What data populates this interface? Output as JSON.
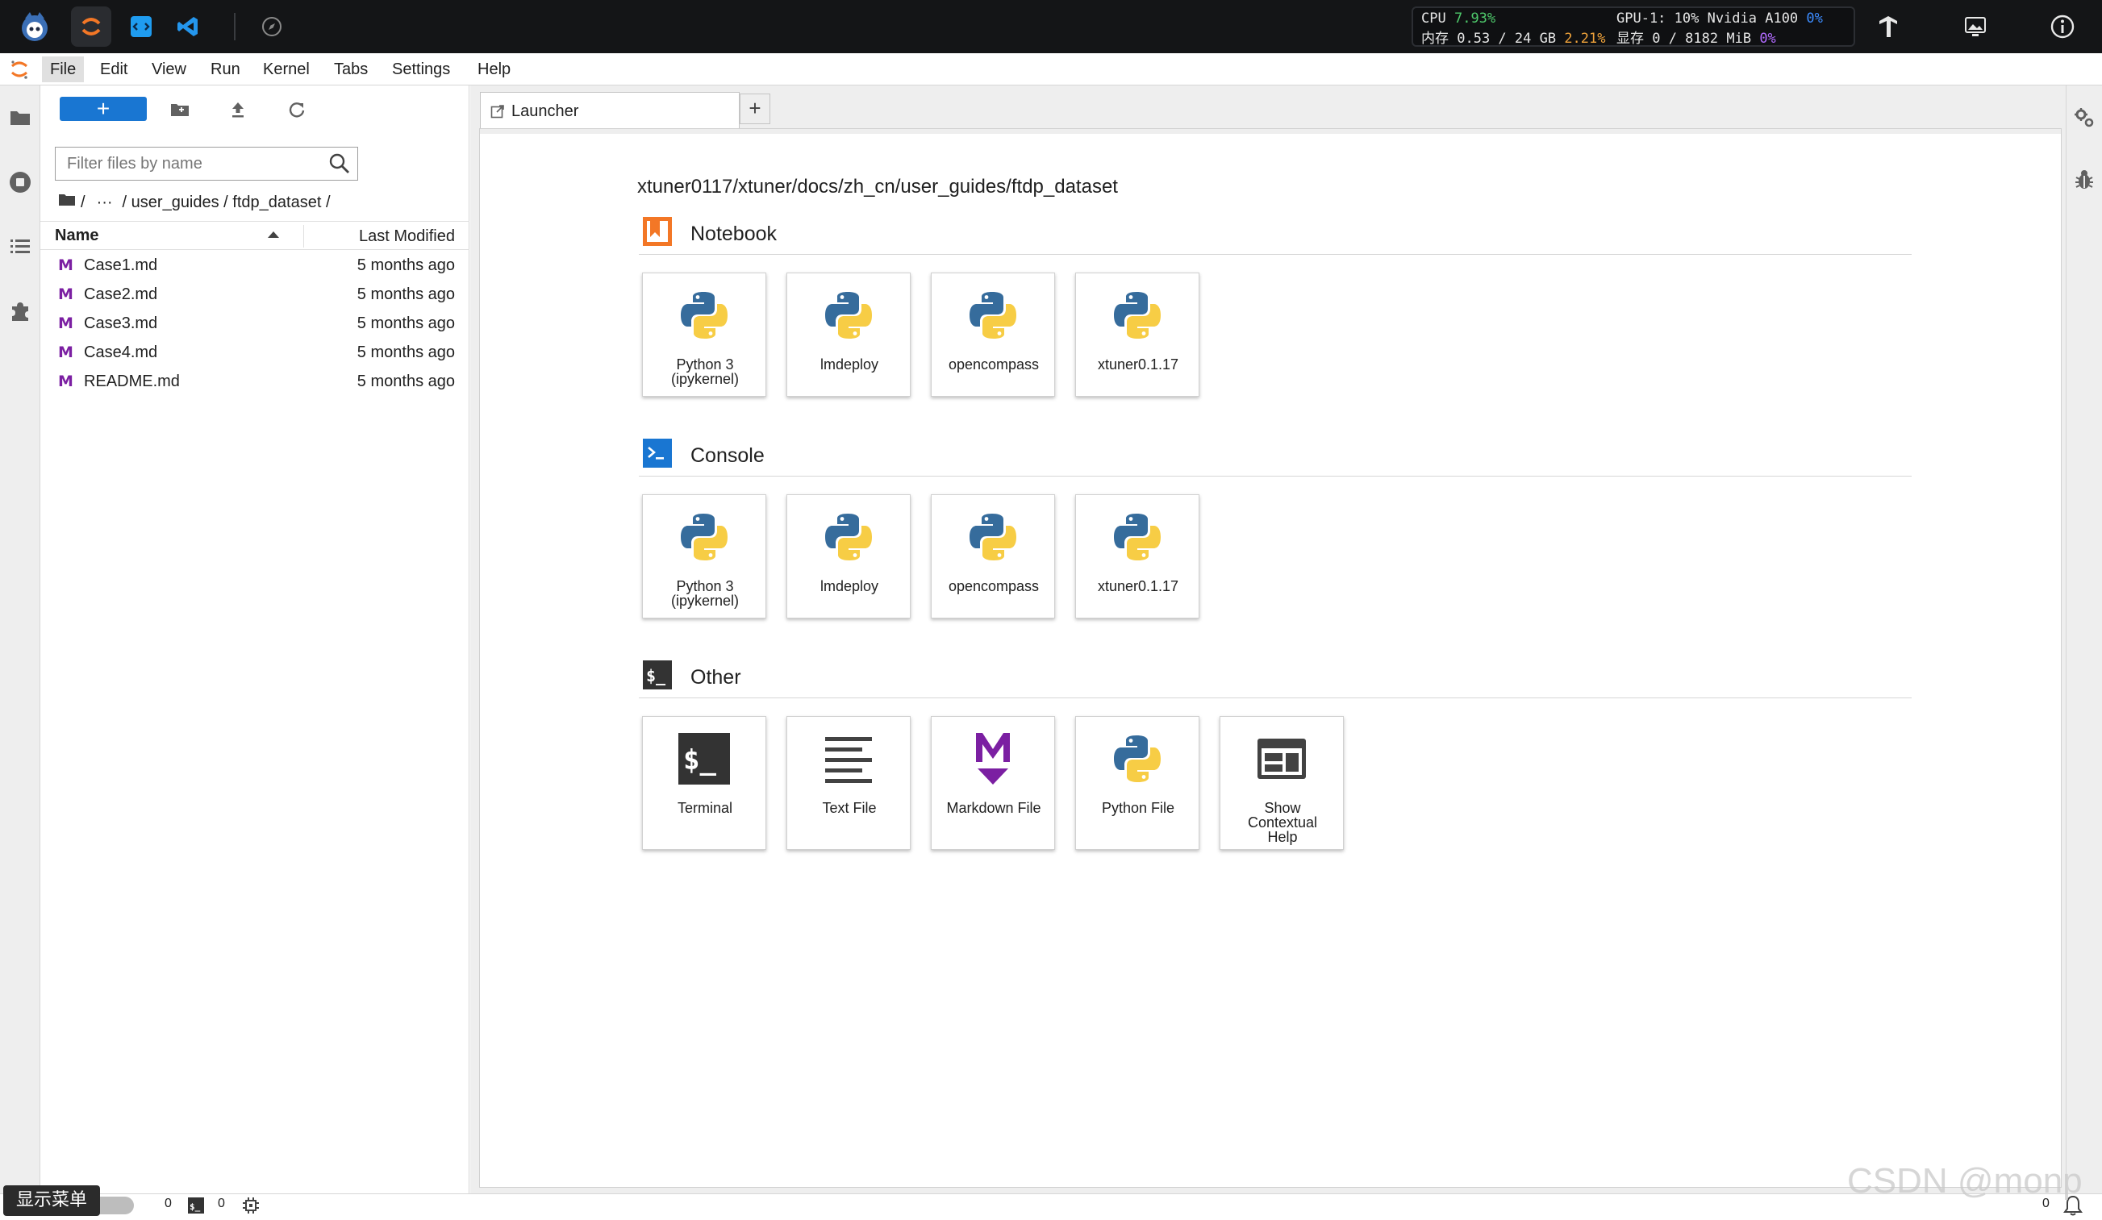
{
  "topbar": {
    "apps": [
      "monitor-app-icon",
      "jupyter-icon",
      "vscode-web-icon",
      "vscode-icon",
      "compass-icon"
    ],
    "monitor": {
      "cpu_label": "CPU",
      "cpu_value": "7.93%",
      "mem_label": "内存 0.53 / 24 GB",
      "mem_value": "2.21%",
      "gpu_label": "GPU-1: 10% Nvidia A100",
      "gpu_value": "0%",
      "vram_label": "显存 0 / 8182 MiB",
      "vram_value": "0%"
    },
    "colors": {
      "green": "#4ec96b",
      "orange": "#f0a33b",
      "blue": "#3c8cff",
      "purple": "#b26bff"
    }
  },
  "menubar": {
    "items": [
      "File",
      "Edit",
      "View",
      "Run",
      "Kernel",
      "Tabs",
      "Settings",
      "Help"
    ]
  },
  "filebrowser": {
    "new_label": "+",
    "filter_placeholder": "Filter files by name",
    "breadcrumb": {
      "root": "/",
      "ellipsis": "···",
      "path": "/ user_guides / ftdp_dataset /"
    },
    "columns": {
      "name": "Name",
      "modified": "Last Modified"
    },
    "files": [
      {
        "name": "Case1.md",
        "modified": "5 months ago"
      },
      {
        "name": "Case2.md",
        "modified": "5 months ago"
      },
      {
        "name": "Case3.md",
        "modified": "5 months ago"
      },
      {
        "name": "Case4.md",
        "modified": "5 months ago"
      },
      {
        "name": "README.md",
        "modified": "5 months ago"
      }
    ],
    "file_icon_letter": "M"
  },
  "launcher": {
    "tab_label": "Launcher",
    "tab_add": "+",
    "cwd": "xtuner0117/xtuner/docs/zh_cn/user_guides/ftdp_dataset",
    "sections": {
      "notebook": {
        "title": "Notebook",
        "cards": [
          {
            "label1": "Python 3",
            "label2": "(ipykernel)"
          },
          {
            "label1": "lmdeploy"
          },
          {
            "label1": "opencompass"
          },
          {
            "label1": "xtuner0.1.17"
          }
        ]
      },
      "console": {
        "title": "Console",
        "cards": [
          {
            "label1": "Python 3",
            "label2": "(ipykernel)"
          },
          {
            "label1": "lmdeploy"
          },
          {
            "label1": "opencompass"
          },
          {
            "label1": "xtuner0.1.17"
          }
        ]
      },
      "other": {
        "title": "Other",
        "cards": [
          {
            "label1": "Terminal"
          },
          {
            "label1": "Text File"
          },
          {
            "label1": "Markdown File"
          },
          {
            "label1": "Python File"
          },
          {
            "label1": "Show",
            "label2": "Contextual",
            "label3": "Help"
          }
        ]
      }
    }
  },
  "statusbar": {
    "show_menu": "显示菜单",
    "terminals_count": "0",
    "kernels_count": "0",
    "notifications_count": "0"
  },
  "watermark": "CSDN @monp"
}
